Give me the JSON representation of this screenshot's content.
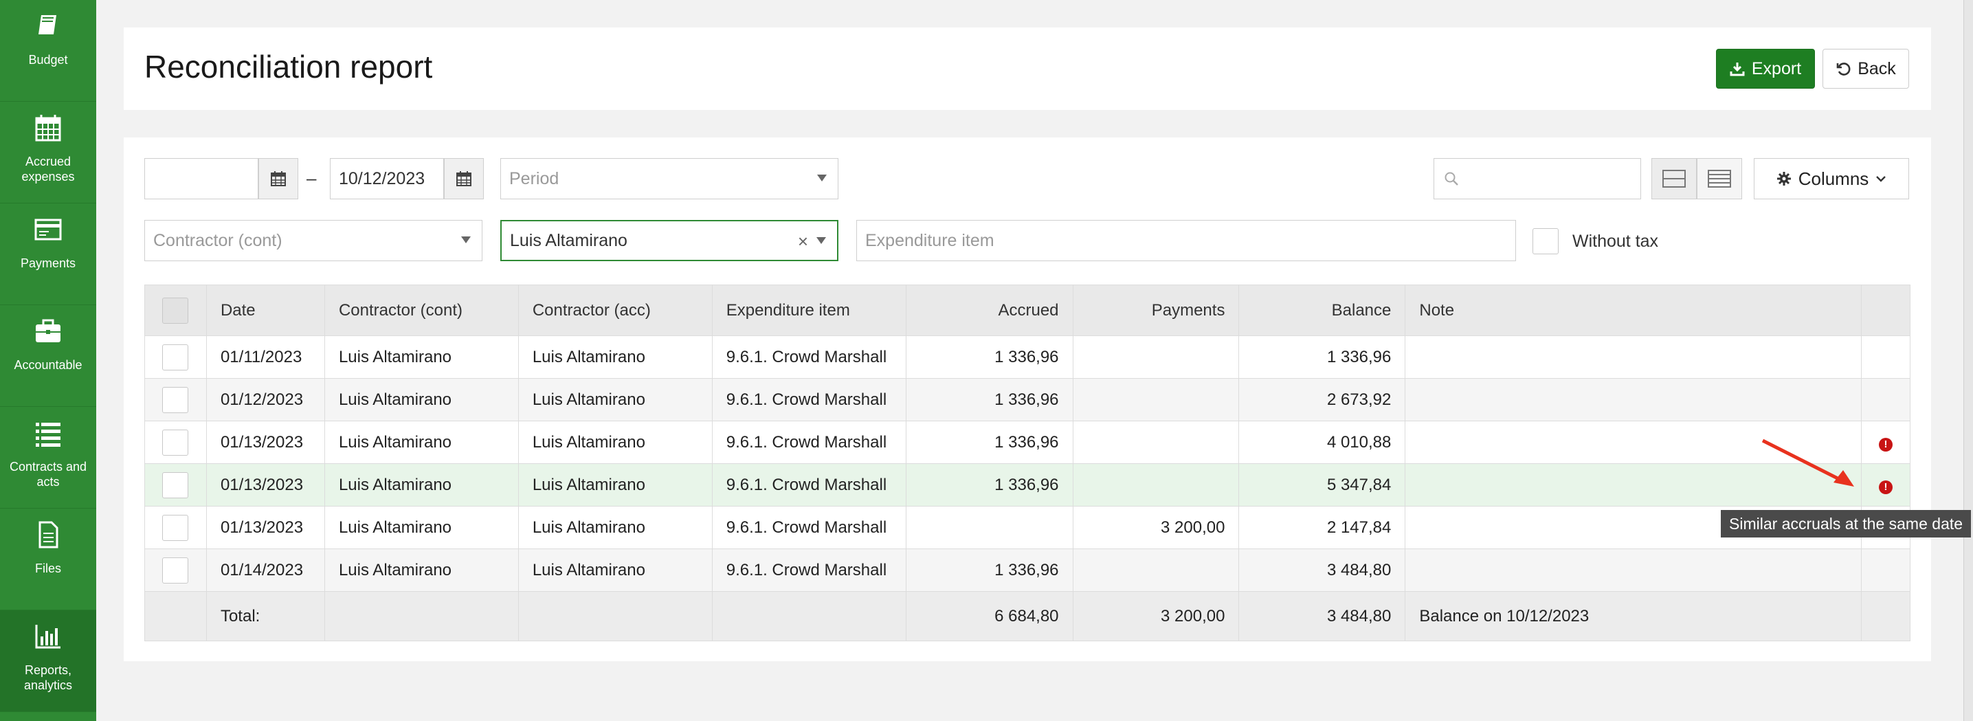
{
  "sidebar": {
    "items": [
      {
        "label": "Budget",
        "icon": "book-icon"
      },
      {
        "label": "Accrued expenses",
        "icon": "calendar-icon"
      },
      {
        "label": "Payments",
        "icon": "payment-card-icon"
      },
      {
        "label": "Accountable",
        "icon": "briefcase-icon"
      },
      {
        "label": "Contracts and acts",
        "icon": "list-icon"
      },
      {
        "label": "Files",
        "icon": "file-icon"
      },
      {
        "label": "Reports, analytics",
        "icon": "bar-chart-icon"
      }
    ],
    "active": "Reports, analytics",
    "color": "#2f8a34"
  },
  "header": {
    "title": "Reconciliation report",
    "export_label": "Export",
    "back_label": "Back"
  },
  "filters": {
    "date_from": "",
    "date_separator": "–",
    "date_to": "10/12/2023",
    "period_placeholder": "Period",
    "search_placeholder": "",
    "columns_label": "Columns",
    "contractor_cont_placeholder": "Contractor (cont)",
    "contractor_acc_value": "Luis Altamirano",
    "expenditure_placeholder": "Expenditure item",
    "without_tax_label": "Without tax"
  },
  "table": {
    "columns": [
      "Date",
      "Contractor (cont)",
      "Contractor (acc)",
      "Expenditure item",
      "Accrued",
      "Payments",
      "Balance",
      "Note"
    ],
    "rows": [
      {
        "date": "01/11/2023",
        "cont": "Luis Altamirano",
        "acc": "Luis Altamirano",
        "item": "9.6.1. Crowd Marshall",
        "accrued": "1 336,96",
        "payments": "",
        "balance": "1 336,96",
        "note": "",
        "warning": false
      },
      {
        "date": "01/12/2023",
        "cont": "Luis Altamirano",
        "acc": "Luis Altamirano",
        "item": "9.6.1. Crowd Marshall",
        "accrued": "1 336,96",
        "payments": "",
        "balance": "2 673,92",
        "note": "",
        "warning": false
      },
      {
        "date": "01/13/2023",
        "cont": "Luis Altamirano",
        "acc": "Luis Altamirano",
        "item": "9.6.1. Crowd Marshall",
        "accrued": "1 336,96",
        "payments": "",
        "balance": "4 010,88",
        "note": "",
        "warning": true
      },
      {
        "date": "01/13/2023",
        "cont": "Luis Altamirano",
        "acc": "Luis Altamirano",
        "item": "9.6.1. Crowd Marshall",
        "accrued": "1 336,96",
        "payments": "",
        "balance": "5 347,84",
        "note": "",
        "warning": true
      },
      {
        "date": "01/13/2023",
        "cont": "Luis Altamirano",
        "acc": "Luis Altamirano",
        "item": "9.6.1. Crowd Marshall",
        "accrued": "",
        "payments": "3 200,00",
        "balance": "2 147,84",
        "note": "",
        "warning": false
      },
      {
        "date": "01/14/2023",
        "cont": "Luis Altamirano",
        "acc": "Luis Altamirano",
        "item": "9.6.1. Crowd Marshall",
        "accrued": "1 336,96",
        "payments": "",
        "balance": "3 484,80",
        "note": "",
        "warning": false
      }
    ],
    "footer": {
      "label": "Total:",
      "accrued": "6 684,80",
      "payments": "3 200,00",
      "balance": "3 484,80",
      "note": "Balance on 10/12/2023"
    }
  },
  "tooltip": {
    "text": "Similar accruals at the same date"
  },
  "colors": {
    "accent": "#2f8a34",
    "export": "#1e7e22",
    "warning": "#c81414",
    "arrow": "#e8321e"
  }
}
